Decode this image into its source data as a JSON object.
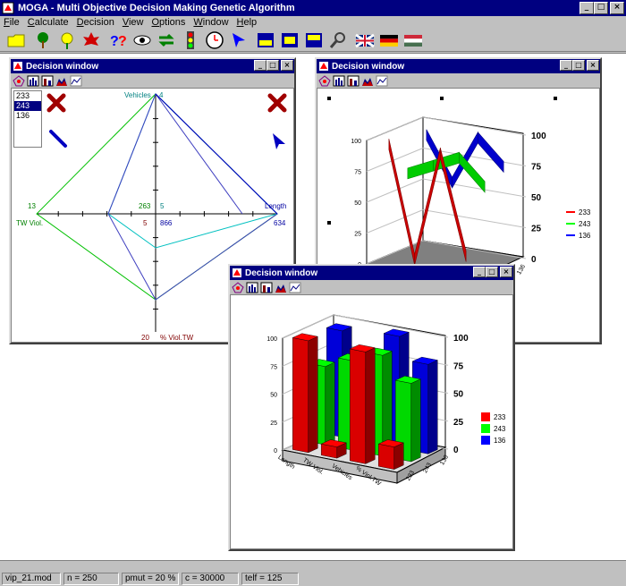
{
  "app": {
    "title": "MOGA - Multi Objective Decision Making Genetic Algorithm"
  },
  "menu": [
    "File",
    "Calculate",
    "Decision",
    "View",
    "Options",
    "Window",
    "Help"
  ],
  "toolbar_icons": [
    "open-folder-icon",
    "tree-icon",
    "flower-icon",
    "leaf-icon",
    "help-icon",
    "eye-icon",
    "swap-icon",
    "traffic-light-icon",
    "clock-icon",
    "pointer-icon",
    "window-bottom-icon",
    "window-center-icon",
    "window-top-icon",
    "search-icon",
    "flag-uk-icon",
    "flag-de-icon",
    "flag-hu-icon"
  ],
  "status": {
    "file": "vip_21.mod",
    "n": "n = 250",
    "pmut": "pmut = 20 %",
    "c": "c = 30000",
    "telf": "telf = 125"
  },
  "windows": [
    {
      "title": "Decision window"
    },
    {
      "title": "Decision window"
    },
    {
      "title": "Decision window"
    }
  ],
  "solutions": [
    {
      "id": "233",
      "color": "#ff0000",
      "selected": false
    },
    {
      "id": "243",
      "color": "#00ff00",
      "selected": true
    },
    {
      "id": "136",
      "color": "#0000ff",
      "selected": false
    }
  ],
  "radar": {
    "axes": {
      "vehicles": {
        "label": "Vehicles",
        "max": "4",
        "min": "5"
      },
      "length": {
        "label": "Length",
        "max": "634",
        "min": "866"
      },
      "tw_viol": {
        "label": "TW Viol.",
        "max": "13",
        "min": "263"
      },
      "pct_viol": {
        "label": "% Viol.TW",
        "max": "20",
        "min": "5"
      }
    }
  },
  "chart_data": [
    {
      "type": "line",
      "title": "",
      "categories": [
        "Length",
        "TW Viol.",
        "Vehicles",
        "% Viol.TW"
      ],
      "zlim": [
        0,
        100
      ],
      "ticks": [
        "0",
        "25",
        "50",
        "75",
        "100"
      ],
      "series": [
        {
          "name": "233",
          "values": [
            100,
            10,
            100,
            20
          ]
        },
        {
          "name": "243",
          "values": [
            70,
            80,
            90,
            70
          ]
        },
        {
          "name": "136",
          "values": [
            95,
            60,
            100,
            80
          ]
        }
      ],
      "legend": "right"
    },
    {
      "type": "bar",
      "title": "",
      "categories": [
        "Length",
        "TW Viol.",
        "Vehicles",
        "% Viol.TW"
      ],
      "ylim": [
        0,
        100
      ],
      "ticks": [
        "0",
        "25",
        "50",
        "75",
        "100"
      ],
      "series": [
        {
          "name": "233",
          "values": [
            100,
            10,
            100,
            20
          ]
        },
        {
          "name": "243",
          "values": [
            70,
            80,
            90,
            70
          ]
        },
        {
          "name": "136",
          "values": [
            95,
            60,
            100,
            80
          ]
        }
      ],
      "legend": "right"
    }
  ]
}
